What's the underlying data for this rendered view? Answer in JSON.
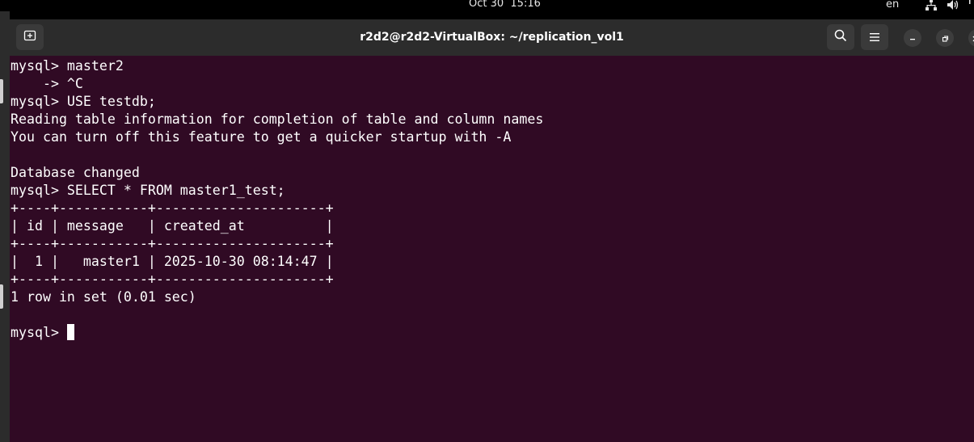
{
  "system_bar": {
    "clock": "Oct 30  15:16",
    "language": "en",
    "icons": [
      "network-icon",
      "volume-icon",
      "power-icon"
    ]
  },
  "window": {
    "title": "r2d2@r2d2-VirtualBox: ~/replication_vol1",
    "buttons": [
      "new-tab-icon",
      "search-icon",
      "menu-icon",
      "minimize-icon",
      "maximize-icon",
      "close-icon"
    ]
  },
  "terminal": {
    "lines": [
      "mysql> master2",
      "    -> ^C",
      "mysql> USE testdb;",
      "Reading table information for completion of table and column names",
      "You can turn off this feature to get a quicker startup with -A",
      "",
      "Database changed",
      "mysql> SELECT * FROM master1_test;",
      "+----+-----------+---------------------+",
      "| id | message   | created_at          |",
      "+----+-----------+---------------------+",
      "|  1 |   master1 | 2025-10-30 08:14:47 |",
      "+----+-----------+---------------------+",
      "1 row in set (0.01 sec)",
      ""
    ],
    "prompt": "mysql> "
  },
  "colors": {
    "terminal_bg": "#300a24",
    "titlebar_bg": "#2c2c2c",
    "text": "#ffffff"
  }
}
